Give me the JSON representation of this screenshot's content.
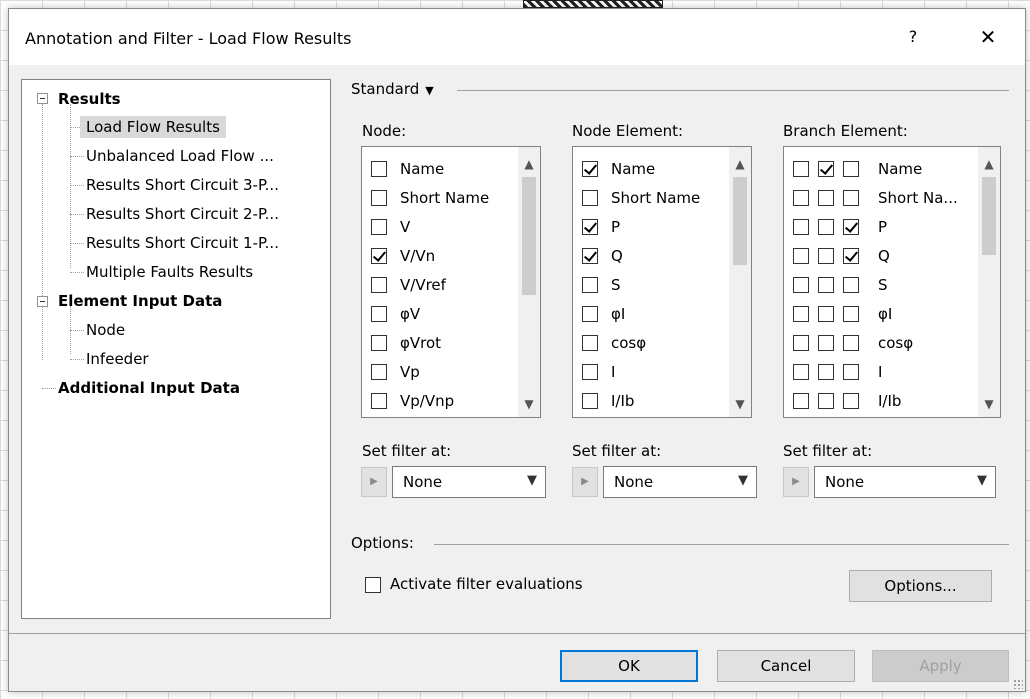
{
  "dialog": {
    "title": "Annotation and Filter - Load Flow Results",
    "help": "?",
    "close": "✕"
  },
  "tree": {
    "items": [
      {
        "label": "Results"
      },
      {
        "label": "Load Flow Results"
      },
      {
        "label": "Unbalanced Load Flow ..."
      },
      {
        "label": "Results Short Circuit 3-P..."
      },
      {
        "label": "Results Short Circuit 2-P..."
      },
      {
        "label": "Results Short Circuit 1-P..."
      },
      {
        "label": "Multiple Faults Results"
      },
      {
        "label": "Element Input Data"
      },
      {
        "label": "Node"
      },
      {
        "label": "Infeeder"
      },
      {
        "label": "Additional Input Data"
      }
    ]
  },
  "standard": {
    "label": "Standard",
    "caret": "▼"
  },
  "node": {
    "label": "Node:",
    "items": [
      {
        "name": "Name",
        "checked": false
      },
      {
        "name": "Short Name",
        "checked": false
      },
      {
        "name": "V",
        "checked": false
      },
      {
        "name": "V/Vn",
        "checked": true
      },
      {
        "name": "V/Vref",
        "checked": false
      },
      {
        "name": "φV",
        "checked": false
      },
      {
        "name": "φVrot",
        "checked": false
      },
      {
        "name": "Vp",
        "checked": false
      },
      {
        "name": "Vp/Vnp",
        "checked": false
      }
    ],
    "filter_label": "Set filter at:",
    "filter_value": "None"
  },
  "node_element": {
    "label": "Node Element:",
    "items": [
      {
        "name": "Name",
        "checked": true
      },
      {
        "name": "Short Name",
        "checked": false
      },
      {
        "name": "P",
        "checked": true
      },
      {
        "name": "Q",
        "checked": true
      },
      {
        "name": "S",
        "checked": false
      },
      {
        "name": "φI",
        "checked": false
      },
      {
        "name": "cosφ",
        "checked": false
      },
      {
        "name": "I",
        "checked": false
      },
      {
        "name": "I/Ib",
        "checked": false
      }
    ],
    "filter_label": "Set filter at:",
    "filter_value": "None"
  },
  "branch_element": {
    "label": "Branch Element:",
    "items": [
      {
        "name": "Name",
        "checks": [
          false,
          true,
          false
        ]
      },
      {
        "name": "Short Na...",
        "checks": [
          false,
          false,
          false
        ]
      },
      {
        "name": "P",
        "checks": [
          false,
          false,
          true
        ]
      },
      {
        "name": "Q",
        "checks": [
          false,
          false,
          true
        ]
      },
      {
        "name": "S",
        "checks": [
          false,
          false,
          false
        ]
      },
      {
        "name": "φI",
        "checks": [
          false,
          false,
          false
        ]
      },
      {
        "name": "cosφ",
        "checks": [
          false,
          false,
          false
        ]
      },
      {
        "name": "I",
        "checks": [
          false,
          false,
          false
        ]
      },
      {
        "name": "I/Ib",
        "checks": [
          false,
          false,
          false
        ]
      }
    ],
    "filter_label": "Set filter at:",
    "filter_value": "None"
  },
  "options": {
    "label": "Options:",
    "activate_label": "Activate filter evaluations",
    "activate_checked": false,
    "options_button": "Options..."
  },
  "footer": {
    "ok": "OK",
    "cancel": "Cancel",
    "apply": "Apply"
  },
  "icons": {
    "scroll_up": "▲",
    "scroll_down": "▼",
    "filter_arrow": "▶",
    "dropdown": "▼"
  }
}
